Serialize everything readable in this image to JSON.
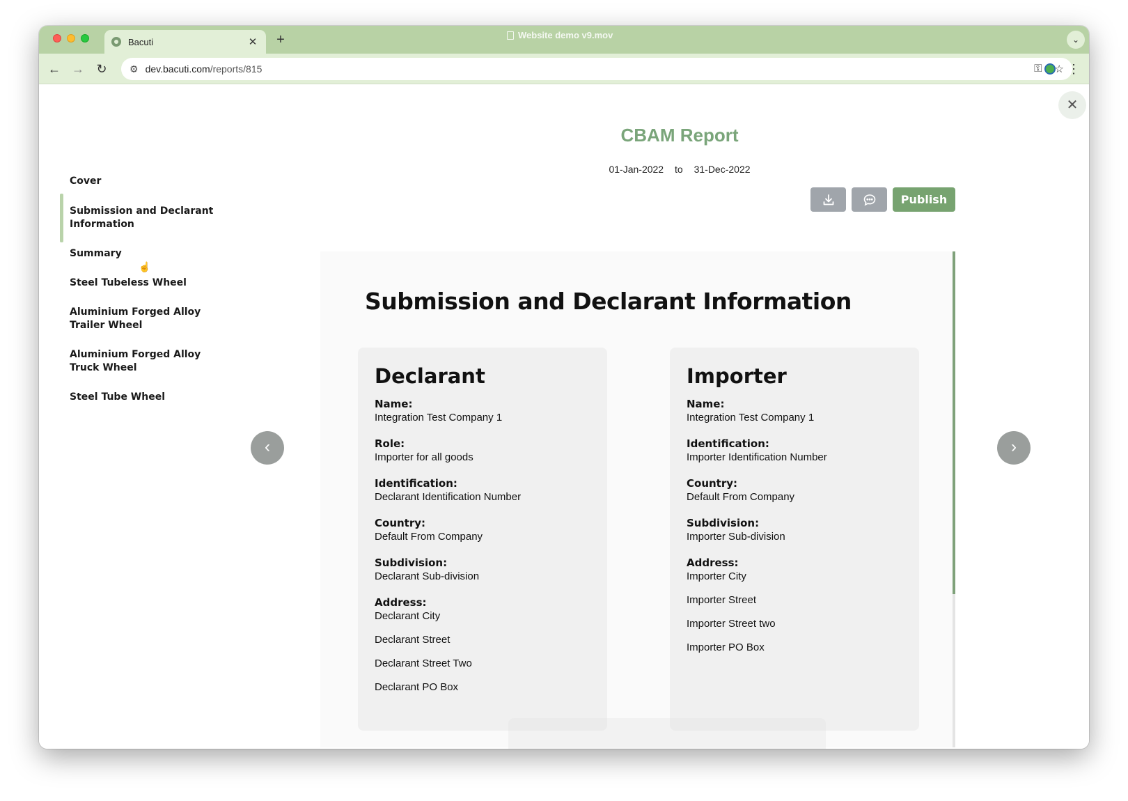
{
  "browser": {
    "tab_title": "Bacuti",
    "tab_close": "✕",
    "new_tab": "+",
    "video_title": "Website demo v9.mov",
    "url_host": "dev.bacuti.com",
    "url_path": "/reports/815"
  },
  "report": {
    "title": "CBAM Report",
    "date_from": "01-Jan-2022",
    "date_sep": "to",
    "date_to": "31-Dec-2022",
    "publish_label": "Publish"
  },
  "sidebar": {
    "items": [
      {
        "label": "Cover",
        "active": false
      },
      {
        "label": "Submission and Declarant Information",
        "active": true
      },
      {
        "label": "Summary",
        "active": false
      },
      {
        "label": "Steel Tubeless Wheel",
        "active": false
      },
      {
        "label": "Aluminium Forged Alloy Trailer Wheel",
        "active": false
      },
      {
        "label": "Aluminium Forged Alloy Truck Wheel",
        "active": false
      },
      {
        "label": "Steel Tube Wheel",
        "active": false
      }
    ]
  },
  "page": {
    "heading": "Submission and Declarant Information",
    "declarant": {
      "title": "Declarant",
      "name_label": "Name:",
      "name_value": "Integration Test Company 1",
      "role_label": "Role:",
      "role_value": "Importer for all goods",
      "id_label": "Identification:",
      "id_value": "Declarant Identification Number",
      "country_label": "Country:",
      "country_value": "Default From Company",
      "subdivision_label": "Subdivision:",
      "subdivision_value": "Declarant Sub-division",
      "address_label": "Address:",
      "address_lines": [
        "Declarant City",
        "Declarant Street",
        "Declarant Street Two",
        "Declarant PO Box"
      ]
    },
    "importer": {
      "title": "Importer",
      "name_label": "Name:",
      "name_value": "Integration Test Company 1",
      "id_label": "Identification:",
      "id_value": "Importer Identification Number",
      "country_label": "Country:",
      "country_value": "Default From Company",
      "subdivision_label": "Subdivision:",
      "subdivision_value": "Importer Sub-division",
      "address_label": "Address:",
      "address_lines": [
        "Importer City",
        "Importer Street",
        "Importer Street two",
        "Importer PO Box"
      ]
    }
  },
  "colors": {
    "accent": "#77a370",
    "title_green": "#7aa57a",
    "tabstrip": "#b8d2a5"
  },
  "icons": {
    "download": "download-icon",
    "comment": "comment-icon",
    "close": "close-icon",
    "prev": "chevron-left-icon",
    "next": "chevron-right-icon"
  }
}
